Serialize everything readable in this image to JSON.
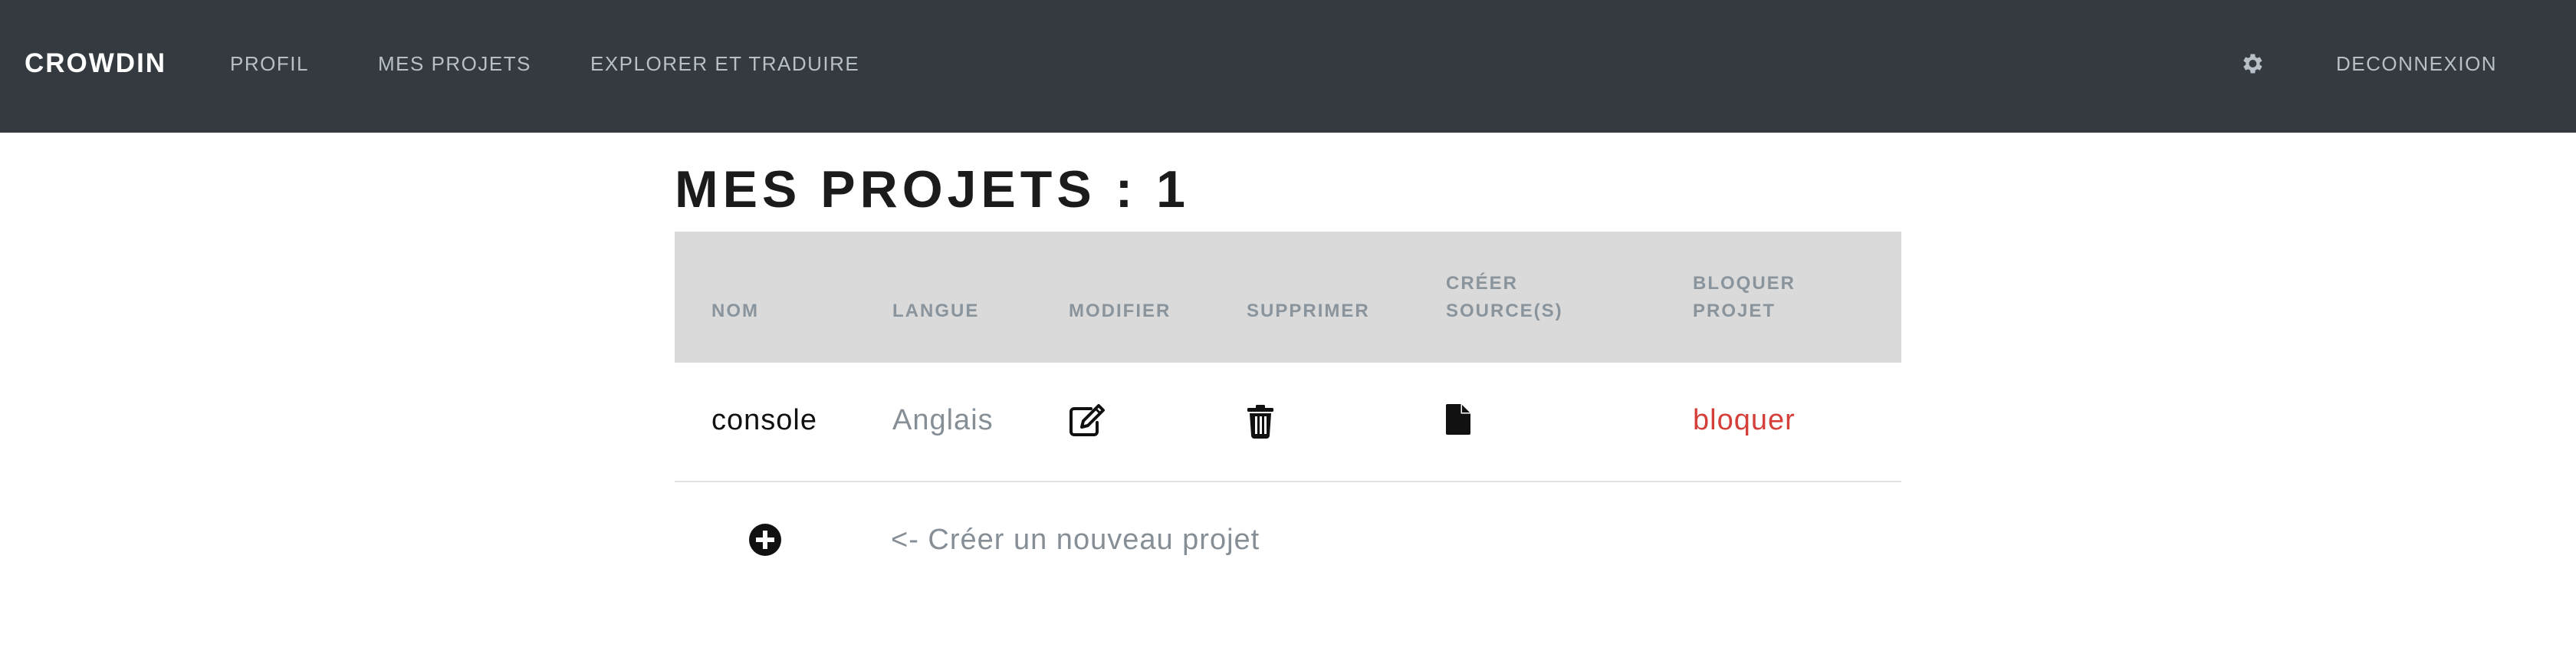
{
  "navbar": {
    "brand": "CROWDIN",
    "links": [
      "PROFIL",
      "MES PROJETS",
      "EXPLORER ET TRADUIRE"
    ],
    "settings_icon": "gear-icon",
    "logout": "DECONNEXION",
    "background": "#343a40"
  },
  "page": {
    "title": "MES PROJETS : 1"
  },
  "table": {
    "headers": {
      "nom": "NOM",
      "langue": "LANGUE",
      "modifier": "MODIFIER",
      "supprimer": "SUPPRIMER",
      "creer_line1": "CRÉER",
      "creer_line2": "SOURCE(S)",
      "bloquer_line1": "BLOQUER",
      "bloquer_line2": "PROJET"
    },
    "rows": [
      {
        "name": "console",
        "language": "Anglais",
        "edit_icon": "edit-icon",
        "delete_icon": "trash-icon",
        "source_icon": "file-icon",
        "block_label": "bloquer"
      }
    ],
    "header_background": "#dadada"
  },
  "add_project": {
    "icon": "plus-circle-icon",
    "label": "<- Créer un nouveau projet"
  },
  "colors": {
    "accent_red": "#d43f3a",
    "muted_text": "#868e96"
  }
}
